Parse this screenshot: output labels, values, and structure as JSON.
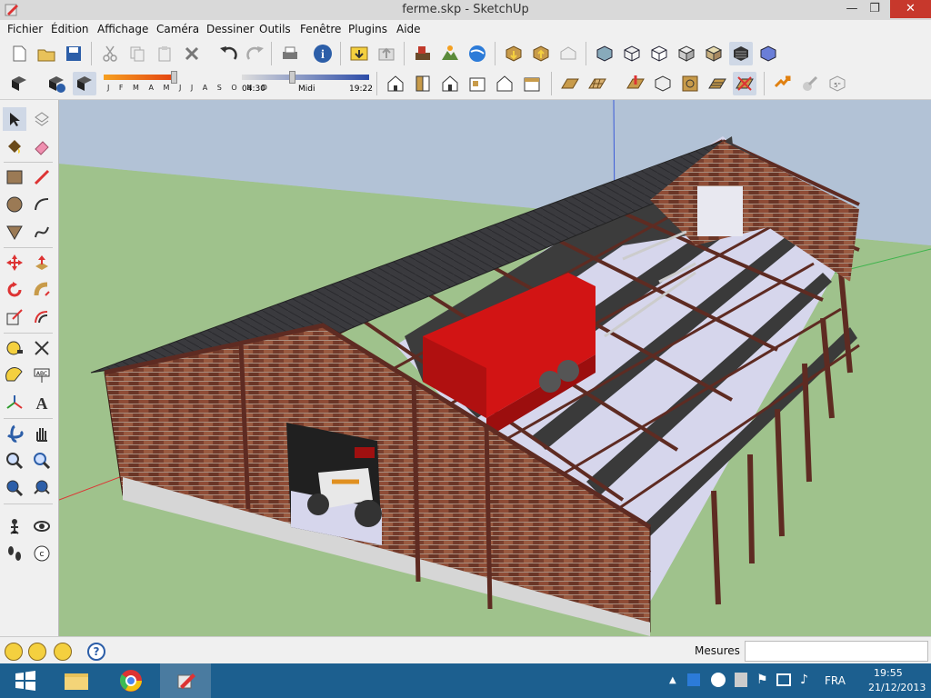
{
  "window": {
    "title": "ferme.skp - SketchUp",
    "min_label": "—",
    "max_label": "❐",
    "close_label": "✕"
  },
  "menu": [
    "Fichier",
    "Édition",
    "Affichage",
    "Caméra",
    "Dessiner",
    "Outils",
    "Fenêtre",
    "Plugins",
    "Aide"
  ],
  "shadow_toolbar": {
    "months": "J F M A M J J A S O N D",
    "time_start": "04:30",
    "time_mid": "Midi",
    "time_end": "19:22"
  },
  "status": {
    "measures_label": "Mesures",
    "measures_value": ""
  },
  "taskbar": {
    "language": "FRA",
    "time": "19:55",
    "date": "21/12/2013"
  },
  "colors": {
    "sky": "#b2c2d6",
    "ground": "#9fc28c",
    "brick": "#7a3f2e",
    "beam": "#5e2b22",
    "floor": "#d6d6ec",
    "trailer": "#d21414",
    "taskbar": "#1c5f8f",
    "close": "#c7382c"
  },
  "toolbar1_icons": [
    "new-icon",
    "open-icon",
    "save-icon",
    "cut-icon",
    "copy-icon",
    "paste-icon",
    "erase-icon",
    "undo-icon",
    "redo-icon",
    "print-icon",
    "model-info-icon",
    "get-models-icon",
    "share-model-icon",
    "add-location-icon",
    "toggle-terrain-icon",
    "google-earth-icon",
    "get-component-icon",
    "share-component-icon",
    "warehouse-icon",
    "xray-icon",
    "wireframe-icon",
    "hidden-line-icon",
    "shaded-icon",
    "shaded-textures-icon",
    "monochrome-icon",
    "style-icon"
  ],
  "toolbar2_icons": [
    "shadows-icon",
    "shadow-settings-icon",
    "display-shadows-icon",
    "iso-view-icon",
    "top-view-icon",
    "front-view-icon",
    "right-view-icon",
    "back-view-icon",
    "left-view-icon",
    "sandbox-smoove-icon",
    "sandbox-stamp-icon",
    "sandbox-drape-icon",
    "sandbox-detail-icon",
    "sandbox-flip-icon",
    "sandbox-from-contours-icon",
    "sandbox-from-scratch-icon",
    "dynamic-interact-icon",
    "dynamic-options-icon",
    "dynamic-attributes-icon"
  ],
  "left_tools": [
    "select-icon",
    "make-component-icon",
    "paint-bucket-icon",
    "eraser-icon",
    "rectangle-icon",
    "line-icon",
    "circle-icon",
    "arc-icon",
    "polygon-icon",
    "freehand-icon",
    "move-icon",
    "push-pull-icon",
    "rotate-icon",
    "follow-me-icon",
    "scale-icon",
    "offset-icon",
    "tape-measure-icon",
    "dimension-icon",
    "protractor-icon",
    "text-icon",
    "axes-icon",
    "3d-text-icon",
    "orbit-icon",
    "pan-icon",
    "zoom-icon",
    "zoom-window-icon",
    "previous-icon",
    "zoom-extents-icon",
    "position-camera-icon",
    "look-around-icon",
    "walk-icon",
    "section-plane-icon"
  ],
  "tray_icons": [
    "show-hidden-icon",
    "dropbox-icon",
    "clock-icon",
    "flag-icon",
    "network-icon",
    "volume-icon",
    "action-center-icon"
  ],
  "taskbar_apps": [
    "windows-start-icon",
    "file-explorer-icon",
    "chrome-icon",
    "sketchup-icon"
  ]
}
